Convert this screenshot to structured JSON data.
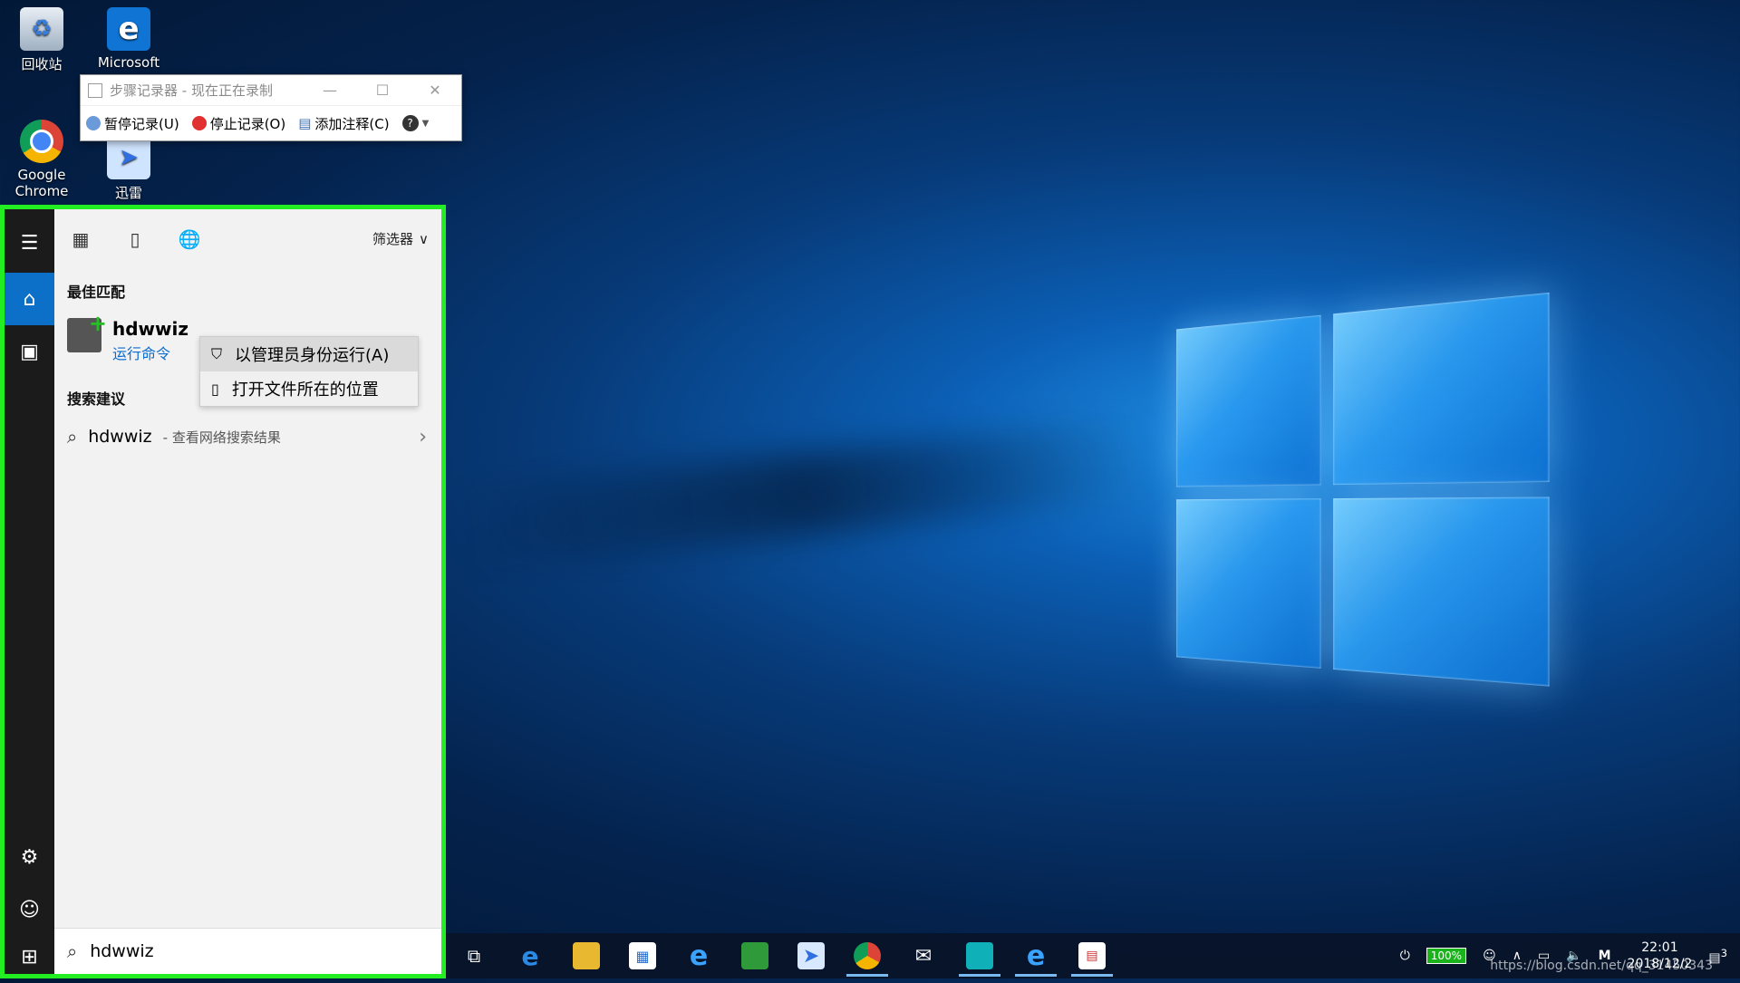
{
  "desktop": {
    "icons": [
      {
        "label": "回收站",
        "icon": "recycle-bin-icon"
      },
      {
        "label": "Microsoft",
        "icon": "edge-icon"
      },
      {
        "label": "Google Chrome",
        "icon": "chrome-icon"
      },
      {
        "label": "迅雷",
        "icon": "xunlei-icon"
      }
    ]
  },
  "recorder": {
    "title": "步骤记录器 - 现在正在录制",
    "pause_label": "暂停记录(U)",
    "stop_label": "停止记录(O)",
    "comment_label": "添加注释(C)",
    "help": "?"
  },
  "start_menu": {
    "filter_label": "筛选器",
    "best_match_header": "最佳匹配",
    "best_match": {
      "name": "hdwwiz",
      "subtitle": "运行命令"
    },
    "context_menu": [
      {
        "label": "以管理员身份运行(A)",
        "icon": "shield-icon"
      },
      {
        "label": "打开文件所在的位置",
        "icon": "file-location-icon"
      }
    ],
    "suggestions_header": "搜索建议",
    "suggestion": {
      "term": "hdwwiz",
      "sub": "- 查看网络搜索结果"
    },
    "search_value": "hdwwiz"
  },
  "taskbar": {
    "battery": "100%",
    "time": "22:01",
    "date": "2018/12/2",
    "ime": "M",
    "watermark": "https://blog.csdn.net/qq_31450343",
    "notifications": "3"
  },
  "colors": {
    "accent": "#0c6fc8",
    "highlight_border": "#22ee22"
  }
}
